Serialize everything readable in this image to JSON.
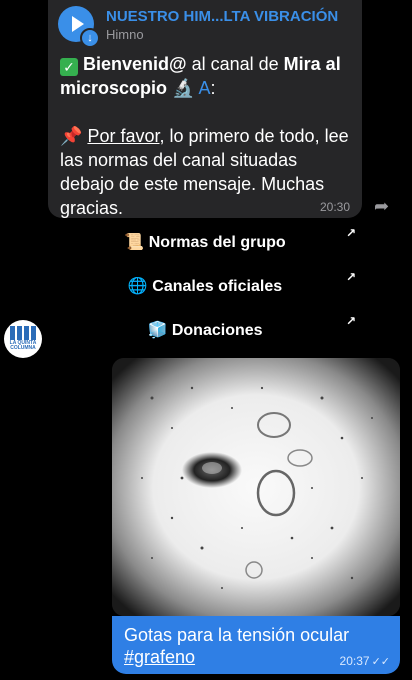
{
  "audio": {
    "title": "NUESTRO HIM...LTA VIBRACIÓN",
    "subtitle": "Himno",
    "play_icon": "play-icon",
    "download_icon": "download-icon"
  },
  "message": {
    "check": "✓",
    "bold1": "Bienvenid@",
    "text1": " al canal de ",
    "bold2": "Mira al microscopio",
    "emoji": "🔬",
    "link": "A",
    "colon": ":",
    "pin": "📌",
    "underline": "Por favor",
    "text2": ", lo primero de todo, lee las normas del canal situadas debajo de este mensaje. Muchas gracias.",
    "time": "20:30"
  },
  "buttons": [
    {
      "icon": "📜",
      "label": "Normas del grupo"
    },
    {
      "icon": "🌐",
      "label": "Canales oficiales"
    },
    {
      "icon": "🧊",
      "label": "Donaciones"
    }
  ],
  "avatar": {
    "label": "LA QUINTA COLUMNA"
  },
  "outgoing": {
    "text": "Gotas para la tensión ocular",
    "hashtag": "#grafeno",
    "time": "20:37",
    "ticks": "✓✓"
  }
}
